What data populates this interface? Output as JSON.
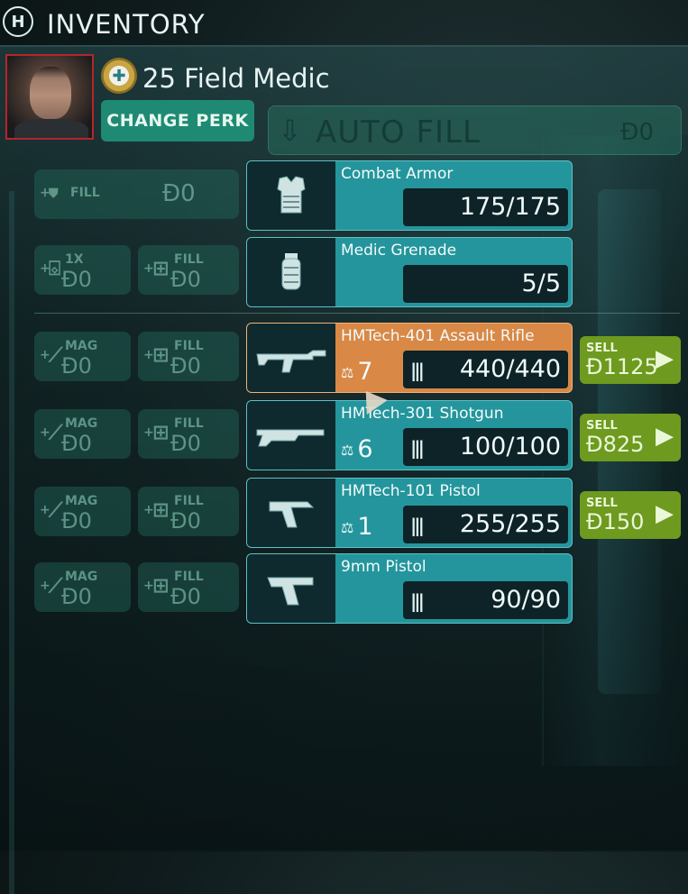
{
  "header": {
    "title": "INVENTORY",
    "logo_icon": "hud-logo-icon"
  },
  "perk": {
    "level_name": "25 Field Medic",
    "change_label": "CHANGE PERK"
  },
  "autofill": {
    "label": "AUTO FILL",
    "price": "Đ0"
  },
  "gear": [
    {
      "name": "Combat Armor",
      "value": "175/175",
      "icon": "armor-icon",
      "buy": [
        {
          "label": "FILL",
          "price": "Đ0",
          "icon": "shield-icon"
        }
      ]
    },
    {
      "name": "Medic Grenade",
      "value": "5/5",
      "icon": "grenade-icon",
      "buy": [
        {
          "label": "1X",
          "price": "Đ0",
          "icon": "grenade-mag-icon"
        },
        {
          "label": "FILL",
          "price": "Đ0",
          "icon": "ammo-crate-icon"
        }
      ]
    }
  ],
  "weapons": [
    {
      "name": "HMTech-401 Assault Rifle",
      "weight": "7",
      "ammo": "440/440",
      "selected": true,
      "icon": "assault-rifle-icon",
      "buy": [
        {
          "label": "MAG",
          "price": "Đ0"
        },
        {
          "label": "FILL",
          "price": "Đ0"
        }
      ],
      "sell": {
        "label": "SELL",
        "price": "Đ1125"
      }
    },
    {
      "name": "HMTech-301 Shotgun",
      "weight": "6",
      "ammo": "100/100",
      "selected": false,
      "icon": "shotgun-icon",
      "buy": [
        {
          "label": "MAG",
          "price": "Đ0"
        },
        {
          "label": "FILL",
          "price": "Đ0"
        }
      ],
      "sell": {
        "label": "SELL",
        "price": "Đ825"
      }
    },
    {
      "name": "HMTech-101 Pistol",
      "weight": "1",
      "ammo": "255/255",
      "selected": false,
      "icon": "medic-pistol-icon",
      "buy": [
        {
          "label": "MAG",
          "price": "Đ0"
        },
        {
          "label": "FILL",
          "price": "Đ0"
        }
      ],
      "sell": {
        "label": "SELL",
        "price": "Đ150"
      }
    },
    {
      "name": "9mm Pistol",
      "ammo": "90/90",
      "selected": false,
      "icon": "9mm-pistol-icon",
      "buy": [
        {
          "label": "MAG",
          "price": "Đ0"
        },
        {
          "label": "FILL",
          "price": "Đ0"
        }
      ]
    }
  ],
  "colors": {
    "accent_teal": "#24959c",
    "selected_orange": "#d98845",
    "sell_green": "#6d9a1f",
    "perk_green": "#1f8a73",
    "portrait_border": "#b3262a"
  }
}
